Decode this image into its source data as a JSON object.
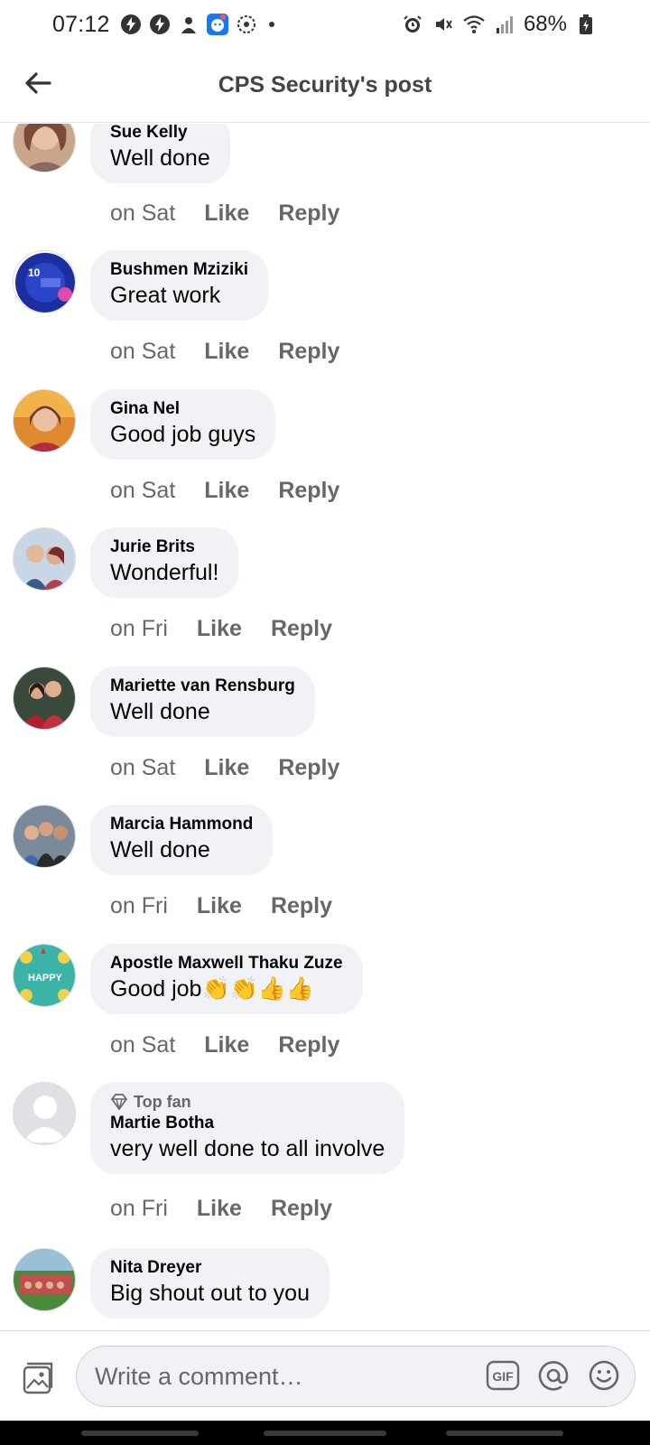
{
  "status_bar": {
    "time": "07:12",
    "battery": "68%",
    "icons_left": [
      "bolt-circle-icon",
      "bolt-circle-icon",
      "app-icon",
      "messenger-icon",
      "settings-dots-icon"
    ],
    "icons_right": [
      "alarm-icon",
      "mute-icon",
      "wifi-icon",
      "signal-icon",
      "battery-icon"
    ]
  },
  "header": {
    "title": "CPS Security's post"
  },
  "comments": [
    {
      "author": "Sue Kelly",
      "text": "Well done",
      "time": "on Sat",
      "like": "Like",
      "reply": "Reply"
    },
    {
      "author": "Bushmen Mziziki",
      "text": "Great work",
      "time": "on Sat",
      "like": "Like",
      "reply": "Reply"
    },
    {
      "author": "Gina Nel",
      "text": "Good job guys",
      "time": "on Sat",
      "like": "Like",
      "reply": "Reply"
    },
    {
      "author": "Jurie Brits",
      "text": "Wonderful!",
      "time": "on Fri",
      "like": "Like",
      "reply": "Reply"
    },
    {
      "author": "Mariette van Rensburg",
      "text": "Well done",
      "time": "on Sat",
      "like": "Like",
      "reply": "Reply"
    },
    {
      "author": "Marcia Hammond",
      "text": "Well done",
      "time": "on Fri",
      "like": "Like",
      "reply": "Reply"
    },
    {
      "author": "Apostle Maxwell Thaku Zuze",
      "text": "Good job👏👏👍👍",
      "time": "on Sat",
      "like": "Like",
      "reply": "Reply"
    },
    {
      "badge": "Top fan",
      "author": "Martie Botha",
      "text": "very well done to all involve",
      "time": "on Fri",
      "like": "Like",
      "reply": "Reply"
    },
    {
      "author": "Nita Dreyer",
      "text": "Big shout out to you"
    }
  ],
  "composer": {
    "placeholder": "Write a comment…",
    "gif_label": "GIF"
  },
  "colors": {
    "bubble": "#f0f2f5",
    "secondary_text": "#65676b",
    "primary_text": "#050505"
  }
}
